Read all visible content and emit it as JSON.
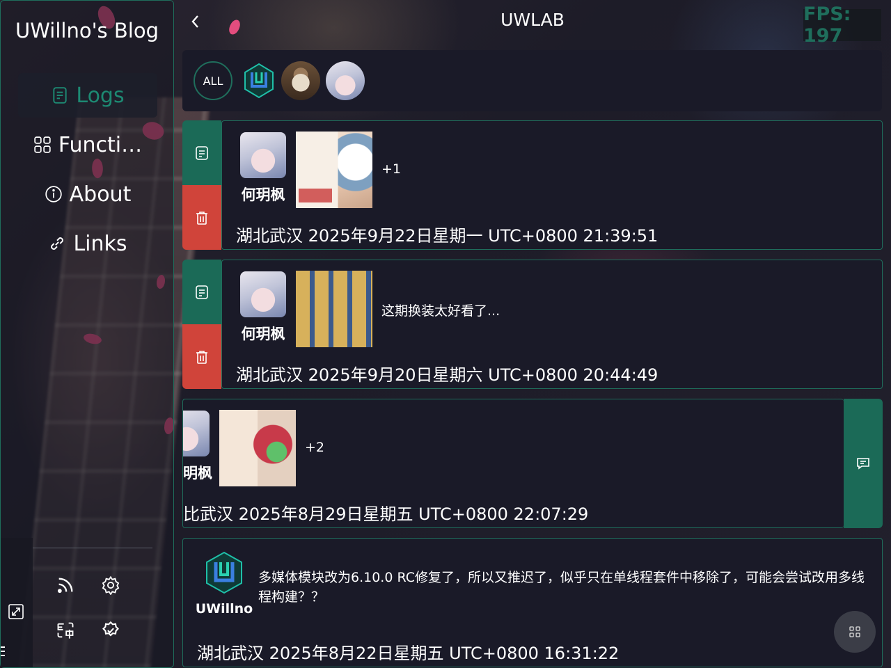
{
  "blog": {
    "title": "UWillno's Blog"
  },
  "nav": [
    {
      "label": "Logs",
      "icon": "document-icon",
      "active": true
    },
    {
      "label": "Functi…",
      "icon": "grid-icon",
      "active": false
    },
    {
      "label": "About",
      "icon": "info-icon",
      "active": false
    },
    {
      "label": "Links",
      "icon": "link-icon",
      "active": false
    }
  ],
  "header": {
    "title": "UWLAB",
    "fps": "FPS: 197"
  },
  "filters": {
    "all_label": "ALL",
    "avatars": [
      "uwillno-logo",
      "cat-photo",
      "anime-girl"
    ]
  },
  "logs": [
    {
      "author": "何玥枫",
      "extra": "+1",
      "message": "",
      "meta": "湖北武汉 2025年9月22日星期一 UTC+0800 21:39:51"
    },
    {
      "author": "何玥枫",
      "extra": "",
      "message": "这期换装太好看了...",
      "meta": "湖北武汉 2025年9月20日星期六 UTC+0800 20:44:49"
    },
    {
      "author": "明枫",
      "extra": "+2",
      "message": "",
      "meta": "比武汉 2025年8月29日星期五 UTC+0800 22:07:29"
    },
    {
      "author": "UWillno",
      "extra": "",
      "message": "多媒体模块改为6.10.0 RC修复了，所以又推迟了，似乎只在单线程套件中移除了，可能会尝试改用多线程构建？？",
      "meta": "湖北武汉 2025年8月22日星期五 UTC+0800 16:31:22"
    }
  ],
  "colors": {
    "accent": "#1f6e5c",
    "danger": "#d0443a",
    "card_bg": "#1a1a28"
  }
}
